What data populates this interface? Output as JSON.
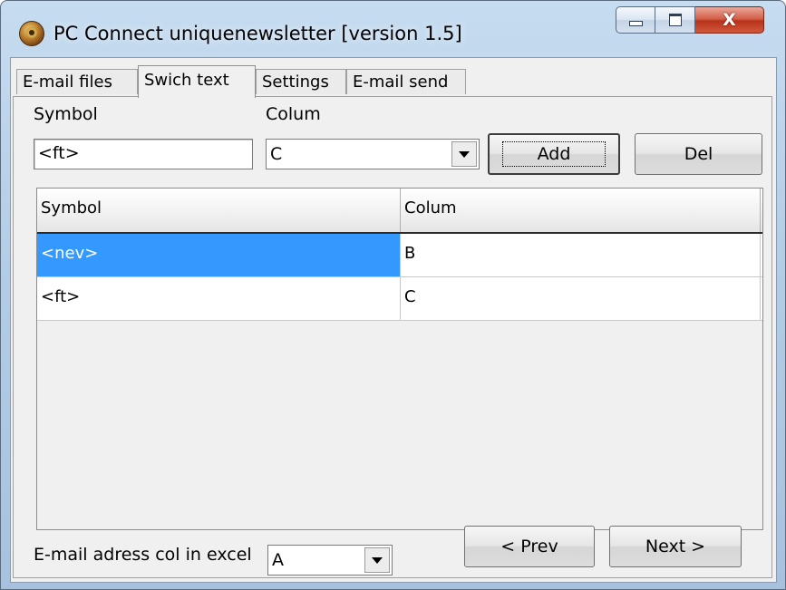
{
  "window": {
    "title": "PC Connect uniquenewsletter [version 1.5]"
  },
  "caption": {
    "minimize": "",
    "maximize": "",
    "close": "X"
  },
  "tabs": [
    {
      "label": "E-mail files",
      "active": false
    },
    {
      "label": "Swich text",
      "active": true
    },
    {
      "label": "Settings",
      "active": false
    },
    {
      "label": "E-mail send",
      "active": false
    }
  ],
  "form": {
    "symbol_label": "Symbol",
    "symbol_value": "<ft>",
    "colum_label": "Colum",
    "colum_value": "C",
    "add_label": "Add",
    "del_label": "Del"
  },
  "table": {
    "headers": [
      "Symbol",
      "Colum"
    ],
    "rows": [
      {
        "symbol": "<nev>",
        "colum": "B",
        "selected": true
      },
      {
        "symbol": "<ft>",
        "colum": "C",
        "selected": false
      }
    ]
  },
  "footer": {
    "email_col_label": "E-mail adress col in excel",
    "email_col_value": "A",
    "prev_label": "< Prev",
    "next_label": "Next >"
  },
  "colors": {
    "selection": "#3399ff",
    "close_button": "#c8402a",
    "titlebar": "#b9d2ea"
  },
  "icons": {
    "app": "app-logo-icon",
    "dropdown": "chevron-down-icon"
  }
}
